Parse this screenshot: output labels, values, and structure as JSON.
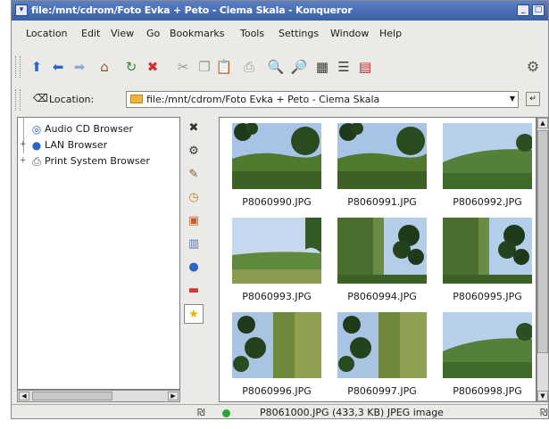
{
  "window": {
    "title": "file:/mnt/cdrom/Foto Evka + Peto - Ciema Skala - Konqueror",
    "minimize_label": "_",
    "maximize_label": "□",
    "menu_label": "▾"
  },
  "menubar": {
    "items": [
      {
        "label": "Location",
        "x": 0
      },
      {
        "label": "Edit"
      },
      {
        "label": "View"
      },
      {
        "label": "Go"
      },
      {
        "label": "Bookmarks"
      },
      {
        "label": "Tools"
      },
      {
        "label": "Settings"
      },
      {
        "label": "Window"
      },
      {
        "label": "Help"
      }
    ]
  },
  "toolbar": {
    "buttons": [
      {
        "name": "up-arrow-icon",
        "glyph": "⬆",
        "color": "#2a64c8"
      },
      {
        "name": "back-arrow-icon",
        "glyph": "⬅",
        "color": "#2a64c8"
      },
      {
        "name": "forward-arrow-icon",
        "glyph": "➡",
        "color": "#8fa8d8"
      },
      {
        "name": "home-icon",
        "glyph": "⌂",
        "color": "#8a5a2a"
      },
      {
        "name": "reload-icon",
        "glyph": "↻",
        "color": "#2a8a3a"
      },
      {
        "name": "stop-icon",
        "glyph": "✖",
        "color": "#d03030"
      },
      {
        "name": "cut-icon",
        "glyph": "✂",
        "color": "#999999"
      },
      {
        "name": "copy-icon",
        "glyph": "❐",
        "color": "#999999"
      },
      {
        "name": "paste-icon",
        "glyph": "📋",
        "color": "#6a6a6a"
      },
      {
        "name": "print-icon",
        "glyph": "⎙",
        "color": "#999999"
      },
      {
        "name": "zoom-in-icon",
        "glyph": "🔍",
        "color": "#2a64c8"
      },
      {
        "name": "zoom-out-icon",
        "glyph": "🔎",
        "color": "#2a64c8"
      },
      {
        "name": "icon-view-icon",
        "glyph": "▦",
        "color": "#3a3a3a"
      },
      {
        "name": "list-view-icon",
        "glyph": "☰",
        "color": "#3a3a3a"
      },
      {
        "name": "detailed-view-icon",
        "glyph": "▤",
        "color": "#c02020"
      }
    ]
  },
  "location": {
    "label": "Location:",
    "value": "file:/mnt/cdrom/Foto Evka + Peto - Ciema Skala"
  },
  "tree": {
    "items": [
      {
        "label": "Audio CD Browser",
        "icon": "cd-icon",
        "glyph": "💿"
      },
      {
        "label": "LAN Browser",
        "icon": "network-icon",
        "glyph": "🌐"
      },
      {
        "label": "Print System Browser",
        "icon": "printer-icon",
        "glyph": "🖶"
      }
    ]
  },
  "sidebar_tabs": [
    {
      "name": "close-sidebar-icon",
      "glyph": "✖",
      "color": "#333333"
    },
    {
      "name": "sidebar-config-icon",
      "glyph": "⚙",
      "color": "#333333"
    },
    {
      "name": "bookmarks-tab-icon",
      "glyph": "✎",
      "color": "#7a5a3a"
    },
    {
      "name": "history-tab-icon",
      "glyph": "◷",
      "color": "#c08020"
    },
    {
      "name": "home-folder-tab-icon",
      "glyph": "▣",
      "color": "#c06030"
    },
    {
      "name": "media-tab-icon",
      "glyph": "▥",
      "color": "#5a7ab0"
    },
    {
      "name": "network-tab-icon",
      "glyph": "●",
      "color": "#2a64c8"
    },
    {
      "name": "services-tab-icon",
      "glyph": "▬",
      "color": "#d03a3a"
    },
    {
      "name": "starred-tab-icon",
      "glyph": "★",
      "color": "#f0b000"
    }
  ],
  "files": [
    {
      "name": "P8060990.JPG",
      "scene": "trees-top"
    },
    {
      "name": "P8060991.JPG",
      "scene": "trees-top"
    },
    {
      "name": "P8060992.JPG",
      "scene": "hill"
    },
    {
      "name": "P8060993.JPG",
      "scene": "field"
    },
    {
      "name": "P8060994.JPG",
      "scene": "tall-trees"
    },
    {
      "name": "P8060995.JPG",
      "scene": "tall-trees"
    },
    {
      "name": "P8060996.JPG",
      "scene": "cliff"
    },
    {
      "name": "P8060997.JPG",
      "scene": "cliff"
    },
    {
      "name": "P8060998.JPG",
      "scene": "hill"
    }
  ],
  "statusbar": {
    "left_mark": "₪",
    "text": "P8061000.JPG (433,3 KB)  JPEG image",
    "right_mark": "₪"
  }
}
